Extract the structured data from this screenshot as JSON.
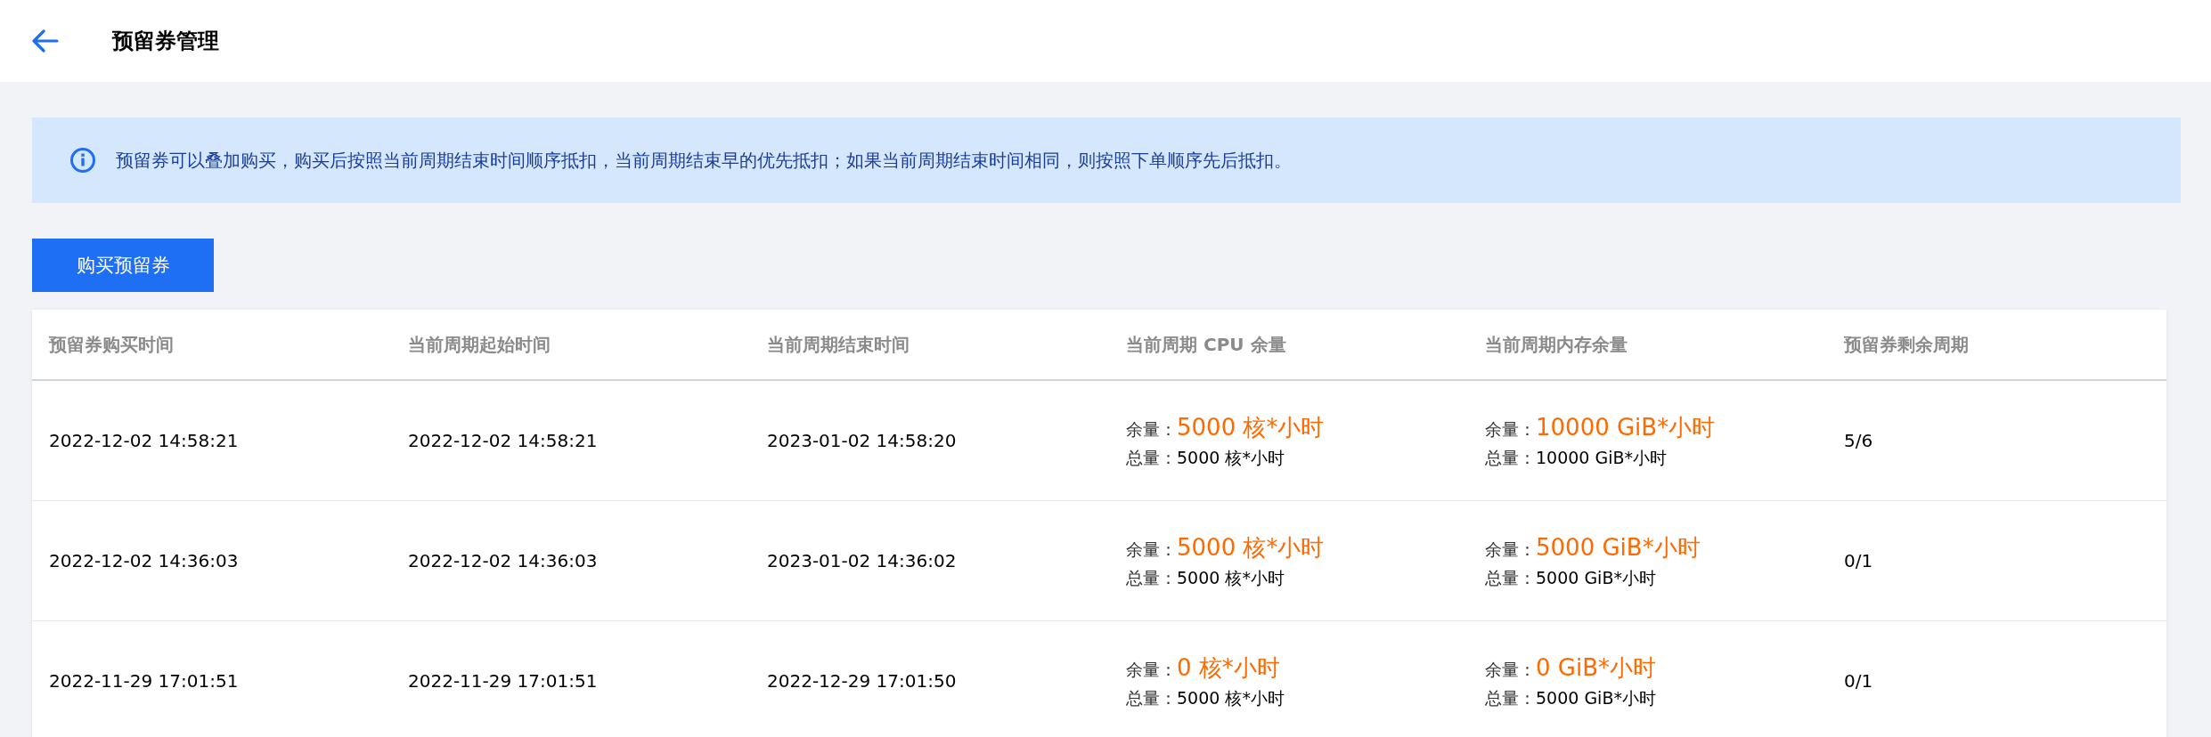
{
  "header": {
    "title": "预留券管理"
  },
  "notice": {
    "text": "预留券可以叠加购买，购买后按照当前周期结束时间顺序抵扣，当前周期结束早的优先抵扣；如果当前周期结束时间相同，则按照下单顺序先后抵扣。"
  },
  "buy_button": {
    "label": "购买预留券"
  },
  "table": {
    "columns": [
      "预留券购买时间",
      "当前周期起始时间",
      "当前周期结束时间",
      "当前周期 CPU 余量",
      "当前周期内存余量",
      "预留券剩余周期"
    ],
    "rows": [
      {
        "purchase_time": "2022-12-02 14:58:21",
        "start_time": "2022-12-02 14:58:21",
        "end_time": "2023-01-02 14:58:20",
        "cpu": {
          "remaining_label": "余量：",
          "remaining": "5000 核*小时",
          "total_label": "总量：",
          "total": "5000 核*小时"
        },
        "memory": {
          "remaining_label": "余量：",
          "remaining": "10000 GiB*小时",
          "total_label": "总量：",
          "total": "10000 GiB*小时"
        },
        "periods_left": "5/6"
      },
      {
        "purchase_time": "2022-12-02 14:36:03",
        "start_time": "2022-12-02 14:36:03",
        "end_time": "2023-01-02 14:36:02",
        "cpu": {
          "remaining_label": "余量：",
          "remaining": "5000 核*小时",
          "total_label": "总量：",
          "total": "5000 核*小时"
        },
        "memory": {
          "remaining_label": "余量：",
          "remaining": "5000 GiB*小时",
          "total_label": "总量：",
          "total": "5000 GiB*小时"
        },
        "periods_left": "0/1"
      },
      {
        "purchase_time": "2022-11-29 17:01:51",
        "start_time": "2022-11-29 17:01:51",
        "end_time": "2022-12-29 17:01:50",
        "cpu": {
          "remaining_label": "余量：",
          "remaining": "0 核*小时",
          "total_label": "总量：",
          "total": "5000 核*小时"
        },
        "memory": {
          "remaining_label": "余量：",
          "remaining": "0 GiB*小时",
          "total_label": "总量：",
          "total": "5000 GiB*小时"
        },
        "periods_left": "0/1"
      }
    ]
  }
}
